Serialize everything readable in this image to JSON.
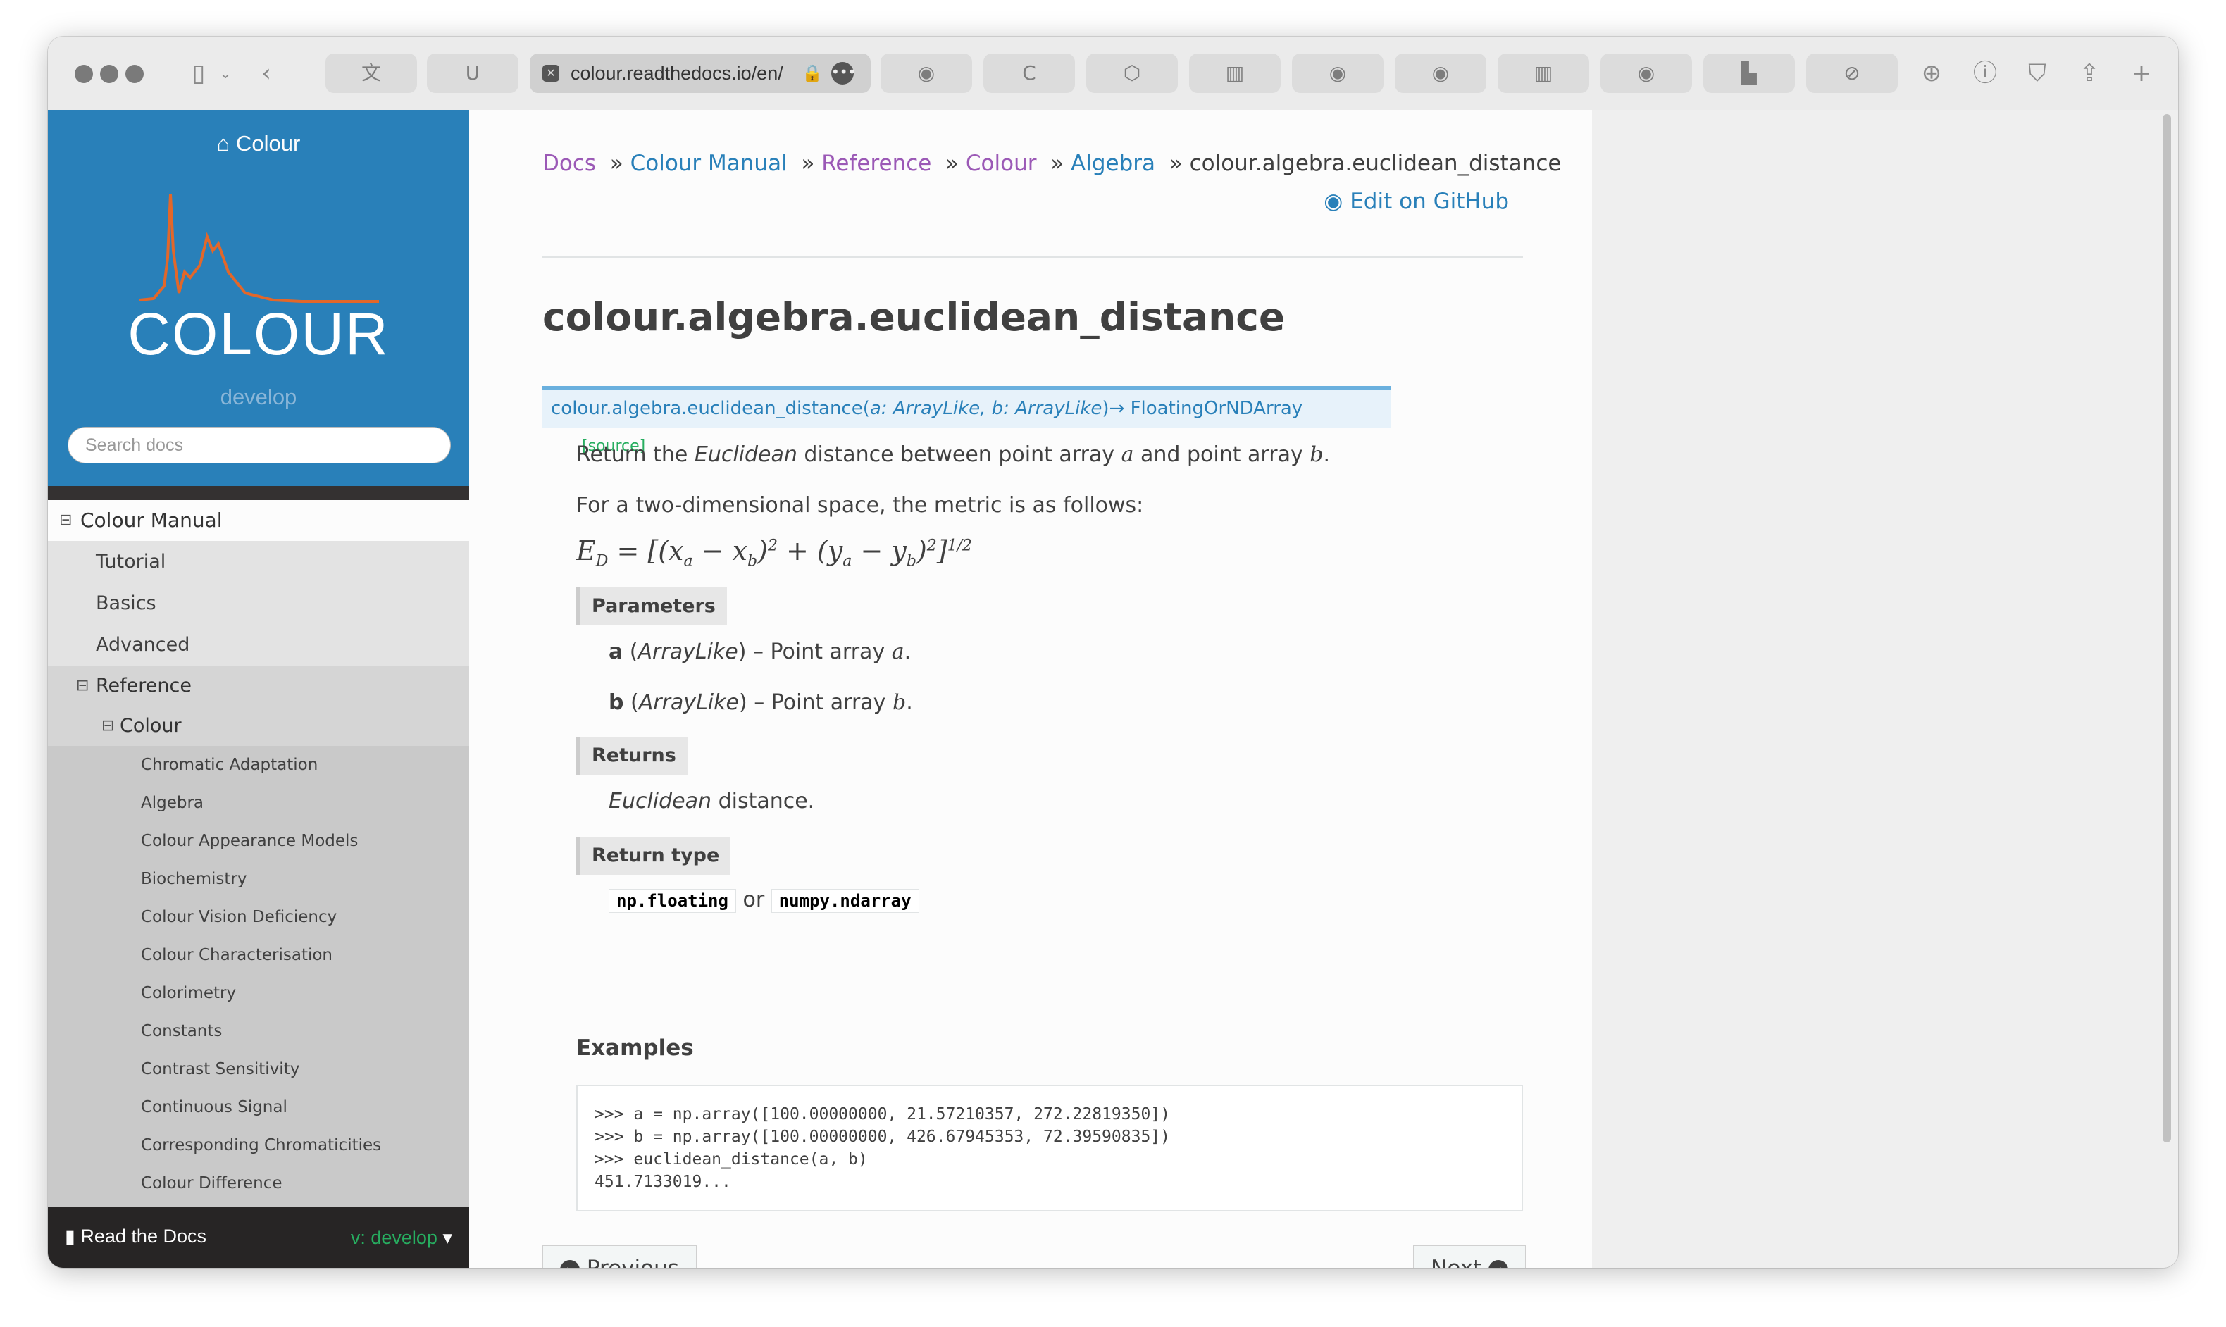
{
  "browser": {
    "url": "colour.readthedocs.io/en/",
    "tab_icons": [
      "translate-icon",
      "u-icon",
      "github-icon",
      "c-icon",
      "cube-icon",
      "reader-icon",
      "github-icon",
      "github-icon",
      "reader-icon",
      "github-icon",
      "bars-icon",
      "compass-icon"
    ]
  },
  "sidebar": {
    "home_label": "Colour",
    "logo_text": "COLOUR",
    "version": "develop",
    "search_placeholder": "Search docs",
    "nav": {
      "manual": "Colour Manual",
      "tutorial": "Tutorial",
      "basics": "Basics",
      "advanced": "Advanced",
      "reference": "Reference",
      "colour": "Colour",
      "items": [
        "Chromatic Adaptation",
        "Algebra",
        "Colour Appearance Models",
        "Biochemistry",
        "Colour Vision Deficiency",
        "Colour Characterisation",
        "Colorimetry",
        "Constants",
        "Contrast Sensitivity",
        "Continuous Signal",
        "Corresponding Chromaticities",
        "Colour Difference"
      ]
    },
    "rtd": {
      "label": "Read the Docs",
      "version": "v: develop"
    }
  },
  "content": {
    "breadcrumbs": {
      "docs": "Docs",
      "manual": "Colour Manual",
      "reference": "Reference",
      "colour": "Colour",
      "algebra": "Algebra",
      "current": "colour.algebra.euclidean_distance"
    },
    "edit_github": "Edit on GitHub",
    "title": "colour.algebra.euclidean_distance",
    "signature": {
      "name": "colour.algebra.euclidean_distance(",
      "params": "a: ArrayLike, b: ArrayLike",
      "ret": ")→ FloatingOrNDArray",
      "source": "[source]"
    },
    "desc": {
      "p1a": "Return the ",
      "p1em": "Euclidean",
      "p1b": " distance between point array ",
      "a": "a",
      "p1c": " and point array ",
      "b": "b",
      "p1d": "."
    },
    "metric_intro": "For a two-dimensional space, the metric is as follows:",
    "parameters_label": "Parameters",
    "params": [
      {
        "name": "a",
        "type": "ArrayLike",
        "desc": " – Point array ",
        "var": "a"
      },
      {
        "name": "b",
        "type": "ArrayLike",
        "desc": " – Point array ",
        "var": "b"
      }
    ],
    "returns_label": "Returns",
    "returns_em": "Euclidean",
    "returns_text": " distance.",
    "return_type_label": "Return type",
    "rt1": "np.floating",
    "rt_or": " or ",
    "rt2": "numpy.ndarray",
    "examples_label": "Examples",
    "code": [
      ">>> a = np.array([100.00000000, 21.57210357, 272.22819350])",
      ">>> b = np.array([100.00000000, 426.67945353, 72.39590835])",
      ">>> euclidean_distance(a, b)",
      "451.7133019..."
    ],
    "prev": "Previous",
    "next": "Next"
  }
}
